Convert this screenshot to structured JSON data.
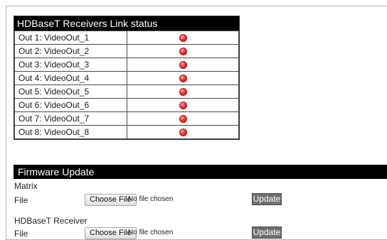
{
  "link_status": {
    "title": "HDBaseT Receivers Link status",
    "outputs": [
      {
        "label": "Out 1: VideoOut_1",
        "status_color": "#e53030"
      },
      {
        "label": "Out 2: VideoOut_2",
        "status_color": "#e53030"
      },
      {
        "label": "Out 3: VideoOut_3",
        "status_color": "#e53030"
      },
      {
        "label": "Out 4: VideoOut_4",
        "status_color": "#e53030"
      },
      {
        "label": "Out 5: VideoOut_5",
        "status_color": "#e53030"
      },
      {
        "label": "Out 6: VideoOut_6",
        "status_color": "#e53030"
      },
      {
        "label": "Out 7: VideoOut_7",
        "status_color": "#e53030"
      },
      {
        "label": "Out 8: VideoOut_8",
        "status_color": "#e53030"
      }
    ]
  },
  "firmware": {
    "title": "Firmware Update",
    "sections": [
      {
        "name": "Matrix",
        "file_label": "File",
        "choose_label": "Choose File",
        "file_status": "No file chosen",
        "update_label": "Update"
      },
      {
        "name": "HDBaseT Receiver",
        "file_label": "File",
        "choose_label": "Choose File",
        "file_status": "No file chosen",
        "update_label": "Update"
      }
    ]
  }
}
